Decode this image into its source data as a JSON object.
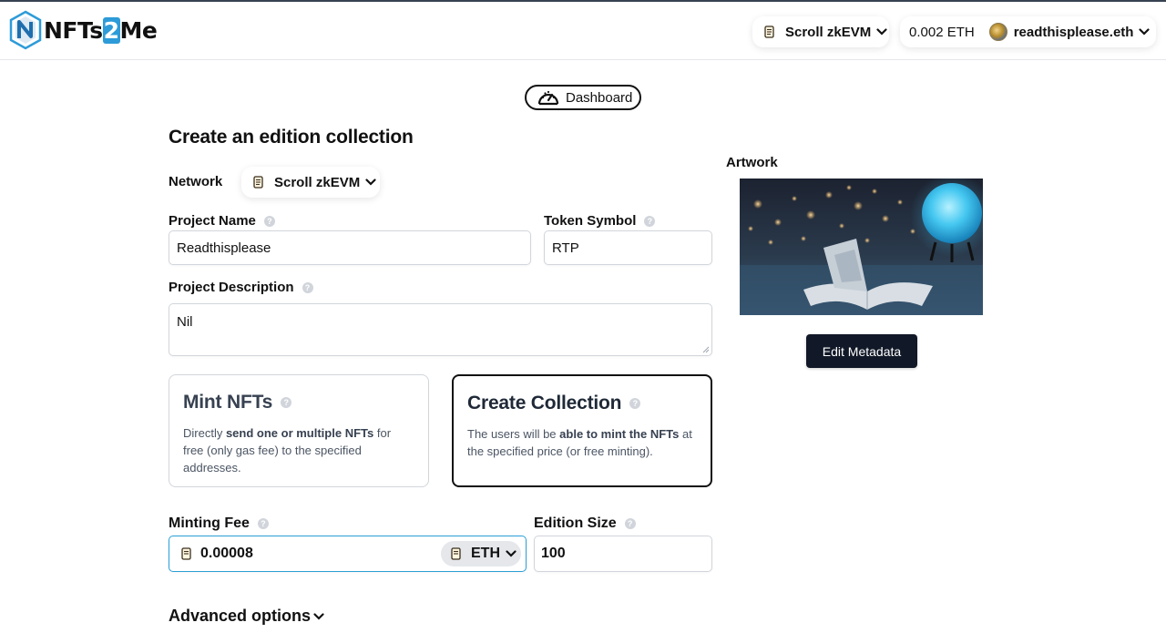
{
  "header": {
    "logo_text_a": "NFTs",
    "logo_text_b": "2",
    "logo_text_c": "Me",
    "network": "Scroll zkEVM",
    "balance": "0.002 ETH",
    "account": "readthisplease.eth"
  },
  "nav": {
    "dashboard_label": "Dashboard"
  },
  "form": {
    "title": "Create an edition collection",
    "network_label": "Network",
    "network_value": "Scroll zkEVM",
    "project_name_label": "Project Name",
    "project_name_value": "Readthisplease",
    "token_symbol_label": "Token Symbol",
    "token_symbol_value": "RTP",
    "description_label": "Project Description",
    "description_value": "Nil",
    "help_glyph": "?",
    "mode_cards": [
      {
        "title": "Mint NFTs",
        "desc_pre": "Directly ",
        "desc_bold": "send one or multiple NFTs",
        "desc_post": " for free (only gas fee) to the specified addresses.",
        "selected": false
      },
      {
        "title": "Create Collection",
        "desc_pre": "The users will be ",
        "desc_bold": "able to mint the NFTs",
        "desc_post": " at the specified price (or free minting).",
        "selected": true
      }
    ],
    "minting_fee_label": "Minting Fee",
    "minting_fee_value": "0.00008",
    "currency": "ETH",
    "edition_size_label": "Edition Size",
    "edition_size_value": "100",
    "advanced_label": "Advanced options"
  },
  "sidebar": {
    "artwork_label": "Artwork",
    "edit_button": "Edit Metadata"
  },
  "colors": {
    "accent": "#2a9fd6",
    "dark_button": "#111827",
    "border": "#d1d5db"
  },
  "icons": [
    "logo-icon",
    "scroll-network-icon",
    "chevron-down-icon",
    "avatar",
    "dashboard-gauge-icon",
    "help-icon"
  ]
}
